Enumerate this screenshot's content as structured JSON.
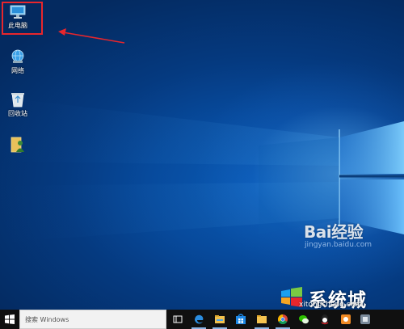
{
  "desktop": {
    "icons": [
      {
        "label": "此电脑",
        "icon": "this-pc-icon"
      },
      {
        "label": "网络",
        "icon": "network-icon"
      },
      {
        "label": "回收站",
        "icon": "recycle-bin-icon"
      },
      {
        "label": "",
        "icon": "user-folder-icon"
      }
    ],
    "highlight_color": "#e8262c",
    "arrow_color": "#e8262c"
  },
  "watermarks": {
    "baidu_text": "Bai经验",
    "baidu_url": "jingyan.baidu.com",
    "site_title": "系统城",
    "site_url": "xitongcheng.com"
  },
  "taskbar": {
    "search_placeholder": "搜索 Windows",
    "apps": [
      {
        "icon": "task-view-icon"
      },
      {
        "icon": "edge-icon"
      },
      {
        "icon": "file-explorer-icon"
      },
      {
        "icon": "store-icon"
      },
      {
        "icon": "folder-icon"
      },
      {
        "icon": "chrome-icon"
      },
      {
        "icon": "wechat-icon"
      },
      {
        "icon": "qq-icon"
      },
      {
        "icon": "orange-app-icon"
      },
      {
        "icon": "app-icon"
      }
    ]
  },
  "colors": {
    "taskbar": "#101010",
    "desktop_dark": "#042a60",
    "desktop_glow": "#78c8ff"
  }
}
